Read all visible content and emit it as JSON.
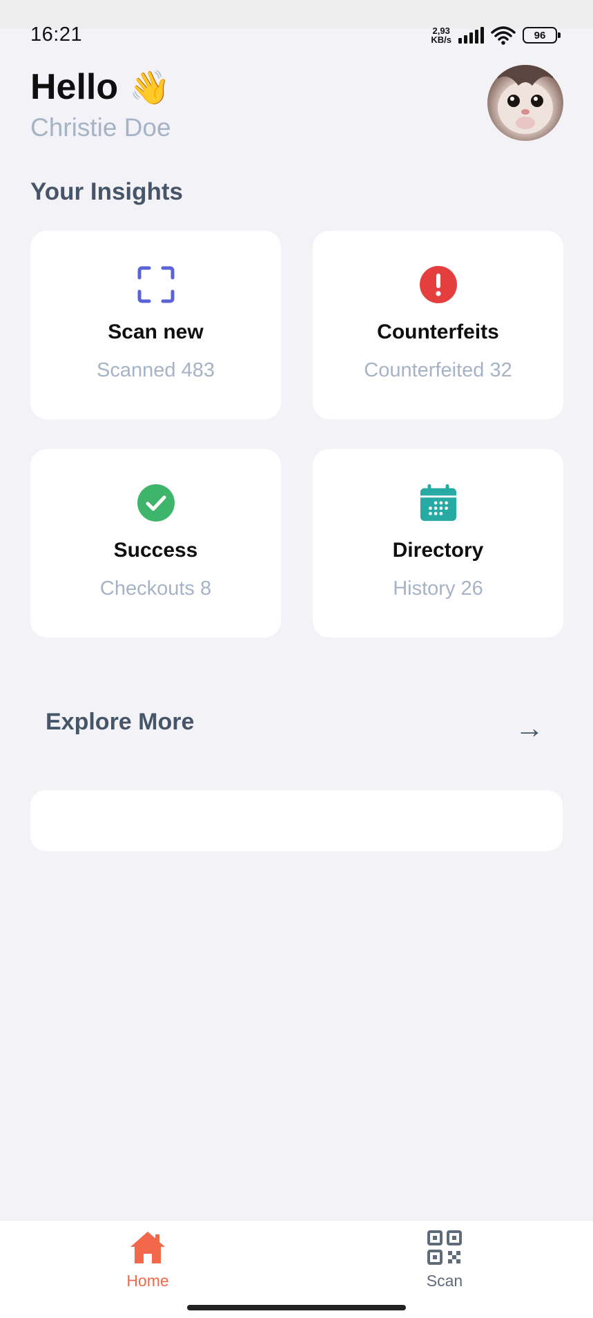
{
  "status_bar": {
    "time": "16:21",
    "net_speed_value": "2,93",
    "net_speed_unit": "KB/s",
    "battery": "96"
  },
  "header": {
    "greeting": "Hello",
    "greeting_emoji": "👋",
    "user_name": "Christie Doe",
    "avatar_icon": "cat-avatar"
  },
  "insights": {
    "title": "Your Insights",
    "cards": [
      {
        "title": "Scan new",
        "subtitle": "Scanned 483",
        "icon": "scan-frame-icon",
        "color": "#5b63d6"
      },
      {
        "title": "Counterfeits",
        "subtitle": "Counterfeited 32",
        "icon": "alert-circle-icon",
        "color": "#e53e3e"
      },
      {
        "title": "Success",
        "subtitle": "Checkouts 8",
        "icon": "check-circle-icon",
        "color": "#3fb56b"
      },
      {
        "title": "Directory",
        "subtitle": "History 26",
        "icon": "calendar-icon",
        "color": "#26aaa3"
      }
    ]
  },
  "explore": {
    "title": "Explore More",
    "arrow": "→"
  },
  "bottom_nav": {
    "items": [
      {
        "label": "Home",
        "icon": "home-icon",
        "active": true,
        "color": "#f2684b"
      },
      {
        "label": "Scan",
        "icon": "qr-code-icon",
        "active": false,
        "color": "#5f6b7a"
      }
    ]
  },
  "colors": {
    "background": "#f3f3f7",
    "card": "#ffffff",
    "muted_text": "#a6b3c6",
    "section_text": "#475569",
    "accent": "#f2684b"
  }
}
